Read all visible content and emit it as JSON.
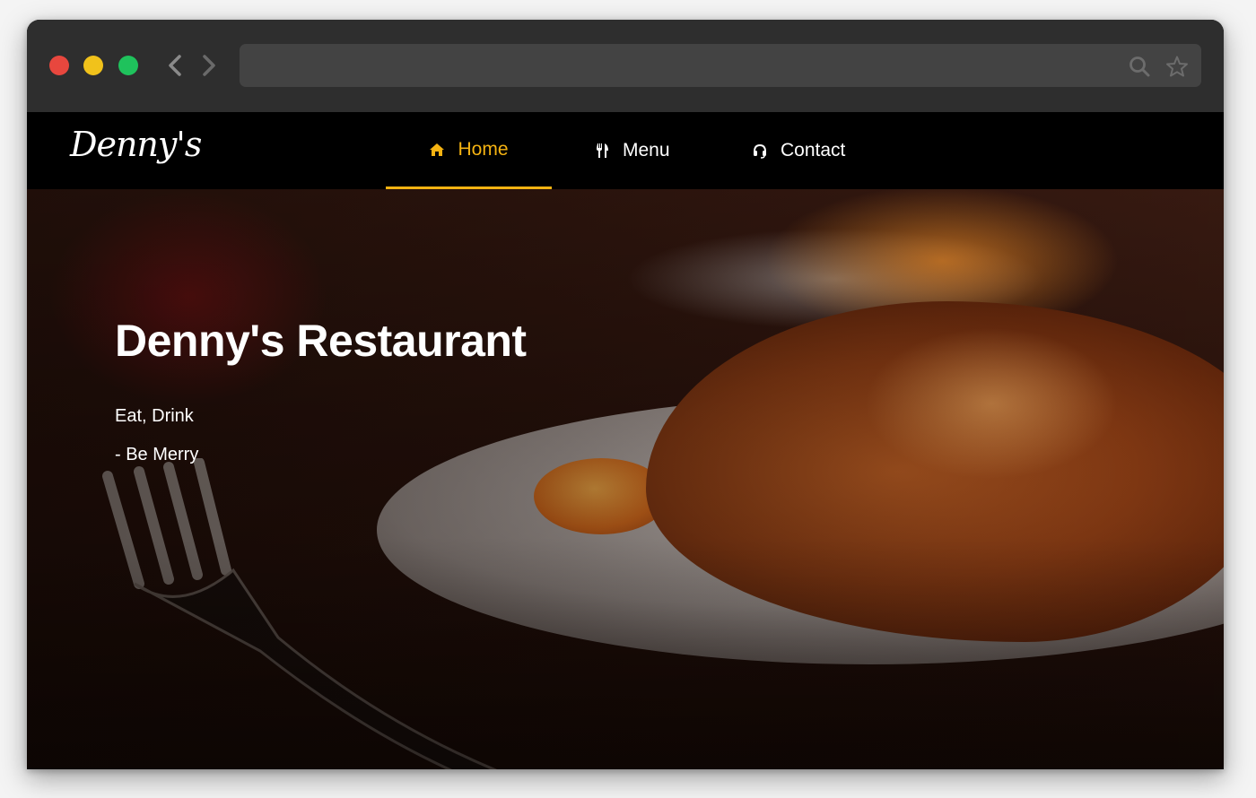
{
  "browser": {
    "url": ""
  },
  "site": {
    "logo_text": "Denny's",
    "nav": [
      {
        "label": "Home",
        "icon": "home-icon",
        "active": true
      },
      {
        "label": "Menu",
        "icon": "fork-knife-icon",
        "active": false
      },
      {
        "label": "Contact",
        "icon": "headset-icon",
        "active": false
      }
    ]
  },
  "hero": {
    "title": "Denny's Restaurant",
    "tagline_1": "Eat, Drink",
    "tagline_2": "- Be Merry"
  },
  "colors": {
    "accent": "#f5b312",
    "nav_bg": "#000000",
    "chrome_bg": "#2e2e2e",
    "urlbar_bg": "#434343"
  }
}
